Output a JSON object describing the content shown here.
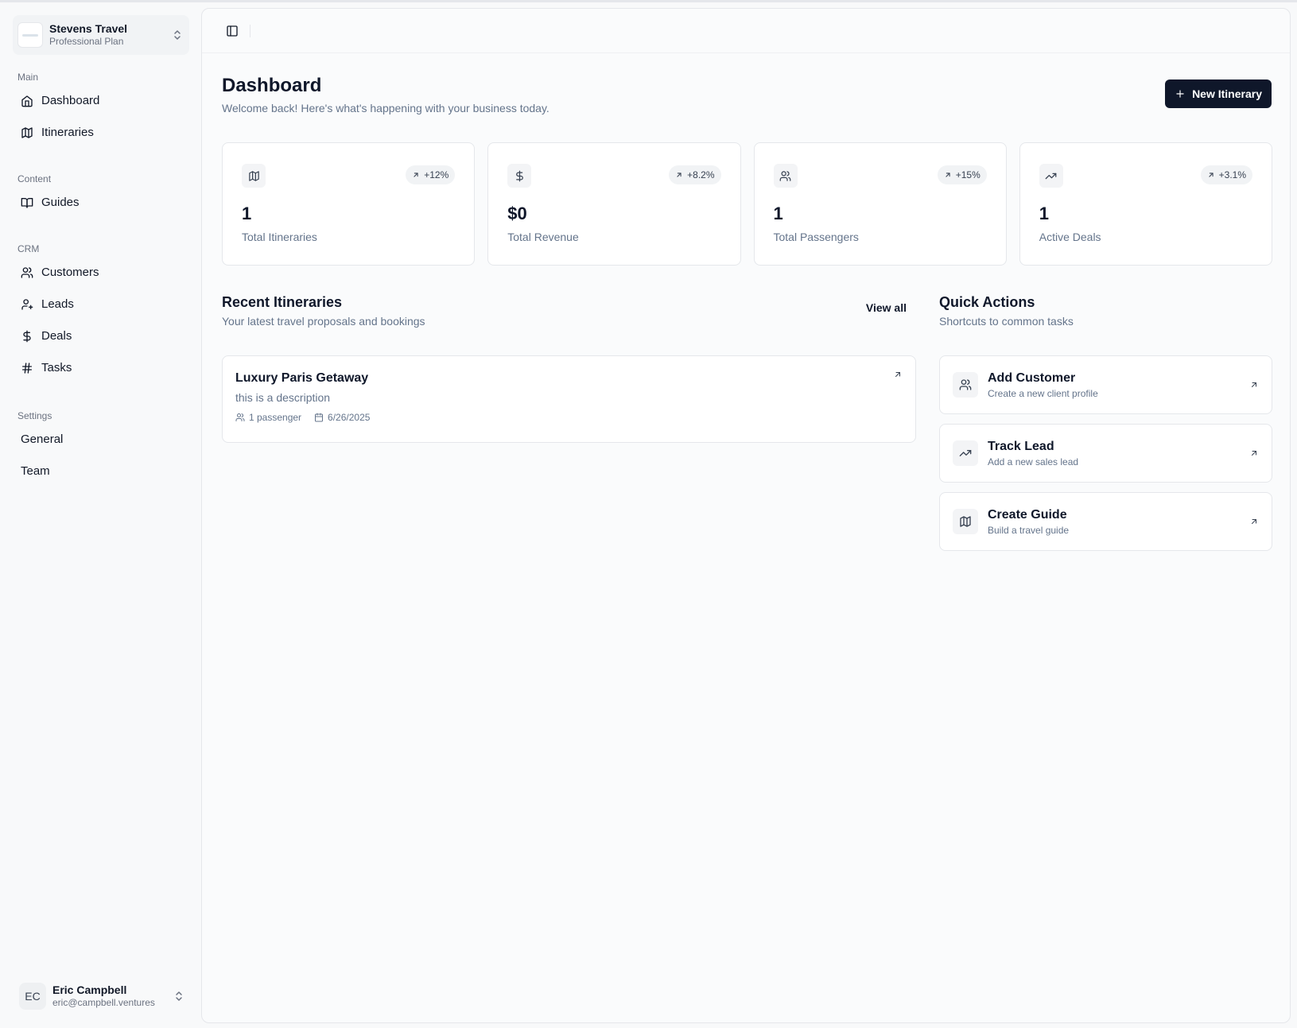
{
  "org": {
    "name": "Stevens Travel",
    "plan": "Professional Plan"
  },
  "nav": {
    "groups": [
      {
        "label": "Main",
        "items": [
          {
            "label": "Dashboard",
            "icon": "home-icon"
          },
          {
            "label": "Itineraries",
            "icon": "map-icon"
          }
        ]
      },
      {
        "label": "Content",
        "items": [
          {
            "label": "Guides",
            "icon": "book-icon"
          }
        ]
      },
      {
        "label": "CRM",
        "items": [
          {
            "label": "Customers",
            "icon": "users-icon"
          },
          {
            "label": "Leads",
            "icon": "user-plus-icon"
          },
          {
            "label": "Deals",
            "icon": "dollar-icon"
          },
          {
            "label": "Tasks",
            "icon": "hash-icon"
          }
        ]
      },
      {
        "label": "Settings",
        "items": [
          {
            "label": "General"
          },
          {
            "label": "Team"
          }
        ]
      }
    ]
  },
  "user": {
    "initials": "EC",
    "name": "Eric Campbell",
    "email": "eric@campbell.ventures"
  },
  "page": {
    "title": "Dashboard",
    "subtitle": "Welcome back! Here's what's happening with your business today.",
    "new_button": "New Itinerary"
  },
  "stats": [
    {
      "value": "1",
      "label": "Total Itineraries",
      "change": "+12%",
      "icon": "map-icon"
    },
    {
      "value": "$0",
      "label": "Total Revenue",
      "change": "+8.2%",
      "icon": "dollar-icon"
    },
    {
      "value": "1",
      "label": "Total Passengers",
      "change": "+15%",
      "icon": "users-icon"
    },
    {
      "value": "1",
      "label": "Active Deals",
      "change": "+3.1%",
      "icon": "trending-up-icon"
    }
  ],
  "recent": {
    "title": "Recent Itineraries",
    "subtitle": "Your latest travel proposals and bookings",
    "view_all": "View all",
    "items": [
      {
        "title": "Luxury Paris Getaway",
        "description": "this is a description",
        "passengers": "1 passenger",
        "date": "6/26/2025"
      }
    ]
  },
  "quick": {
    "title": "Quick Actions",
    "subtitle": "Shortcuts to common tasks",
    "items": [
      {
        "title": "Add Customer",
        "subtitle": "Create a new client profile",
        "icon": "users-icon"
      },
      {
        "title": "Track Lead",
        "subtitle": "Add a new sales lead",
        "icon": "trending-up-icon"
      },
      {
        "title": "Create Guide",
        "subtitle": "Build a travel guide",
        "icon": "map-icon"
      }
    ]
  }
}
